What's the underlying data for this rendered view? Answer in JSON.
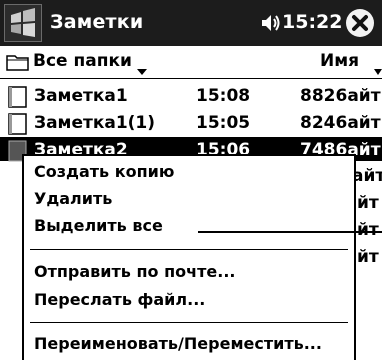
{
  "titlebar": {
    "app_title": "Заметки",
    "clock": "15:22",
    "icons": [
      "windows-start-icon",
      "speaker-icon",
      "close-icon"
    ]
  },
  "folderbar": {
    "folder_label": "Все папки",
    "sort_label": "Имя"
  },
  "files": [
    {
      "name": "Заметка1",
      "time": "15:08",
      "size": "8826айт"
    },
    {
      "name": "Заметка1(1)",
      "time": "15:05",
      "size": "8246айт"
    },
    {
      "name": "Заметка2",
      "time": "15:06",
      "size": "7486айт"
    },
    {
      "name": "",
      "time": "",
      "size": "айт"
    },
    {
      "name": "",
      "time": "",
      "size": "йт"
    },
    {
      "name": "",
      "time": "",
      "size": "йт"
    },
    {
      "name": "",
      "time": "",
      "size": "йт"
    }
  ],
  "context_menu": {
    "items": [
      "Создать копию",
      "Удалить",
      "Выделить все",
      "Отправить по почте...",
      "Переслать файл...",
      "Переименовать/Переместить..."
    ]
  },
  "colors": {
    "titlebar_bg": "#1c1c1c",
    "selection_bg": "#000000",
    "background": "#ffffff"
  }
}
